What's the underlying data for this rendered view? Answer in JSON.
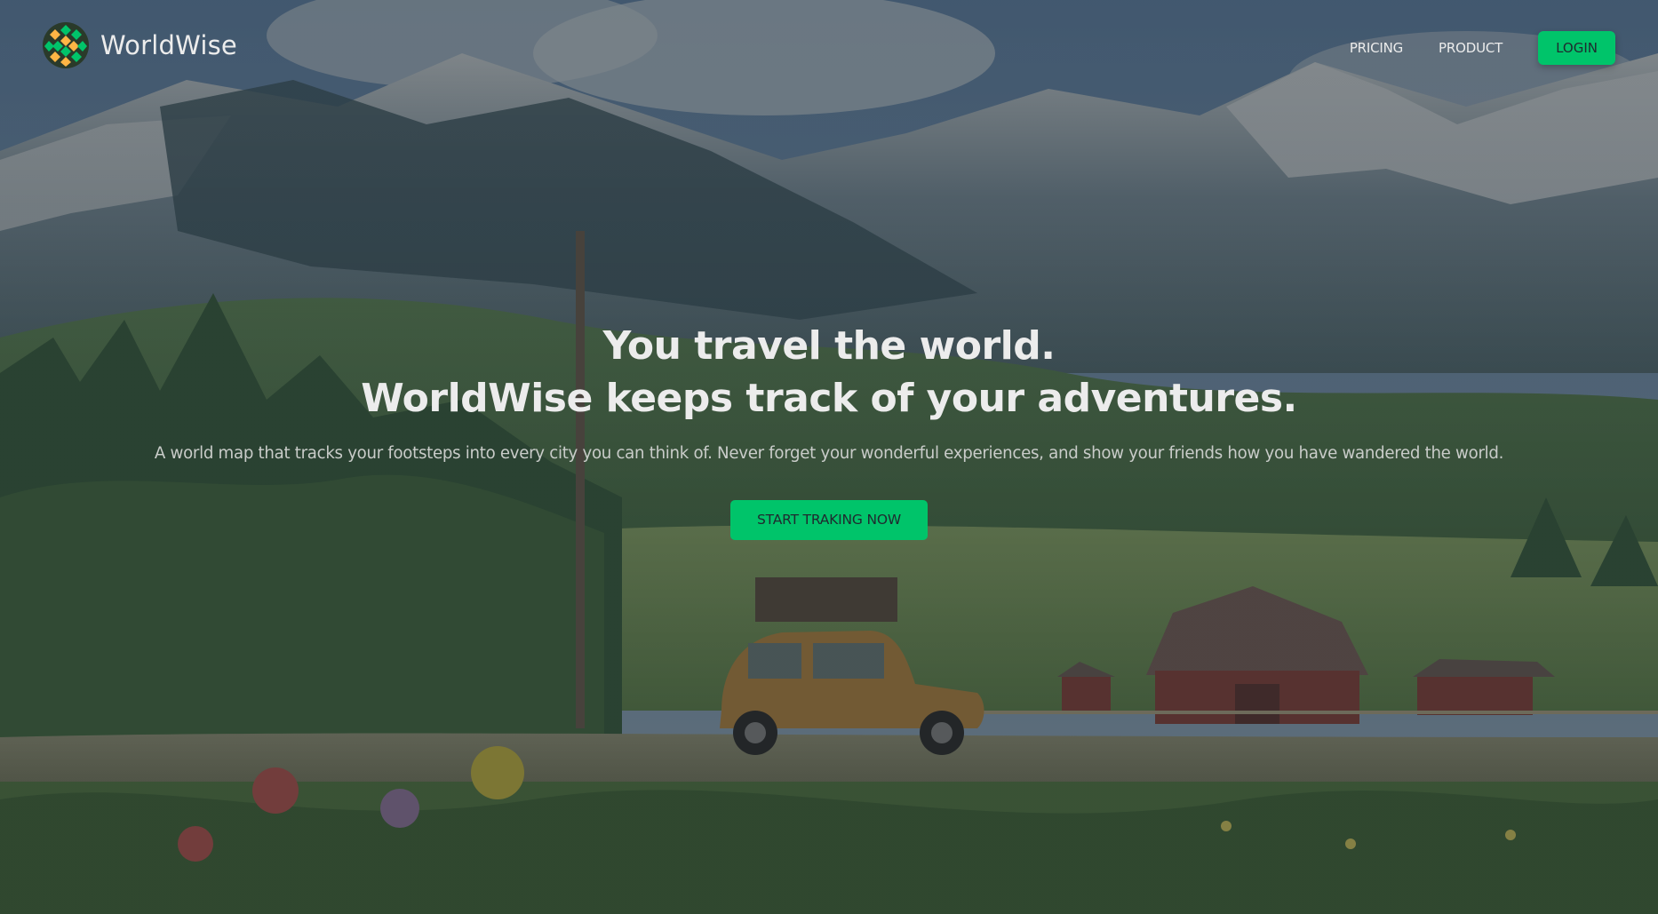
{
  "brand": {
    "name": "WorldWise",
    "icon": "globe-logo-icon",
    "colors": {
      "green": "#00c46a",
      "orange": "#ffb545"
    }
  },
  "nav": {
    "links": [
      {
        "label": "PRICING"
      },
      {
        "label": "PRODUCT"
      }
    ],
    "login_label": "LOGIN"
  },
  "hero": {
    "title_line1": "You travel the world.",
    "title_line2": "WorldWise keeps track of your adventures.",
    "subtitle": "A world map that tracks your footsteps into every city you can think of. Never forget your wonderful experiences, and show your friends how you have wandered the world.",
    "cta_label": "START TRAKING NOW"
  },
  "background": {
    "description_icon": "landscape-illustration"
  }
}
